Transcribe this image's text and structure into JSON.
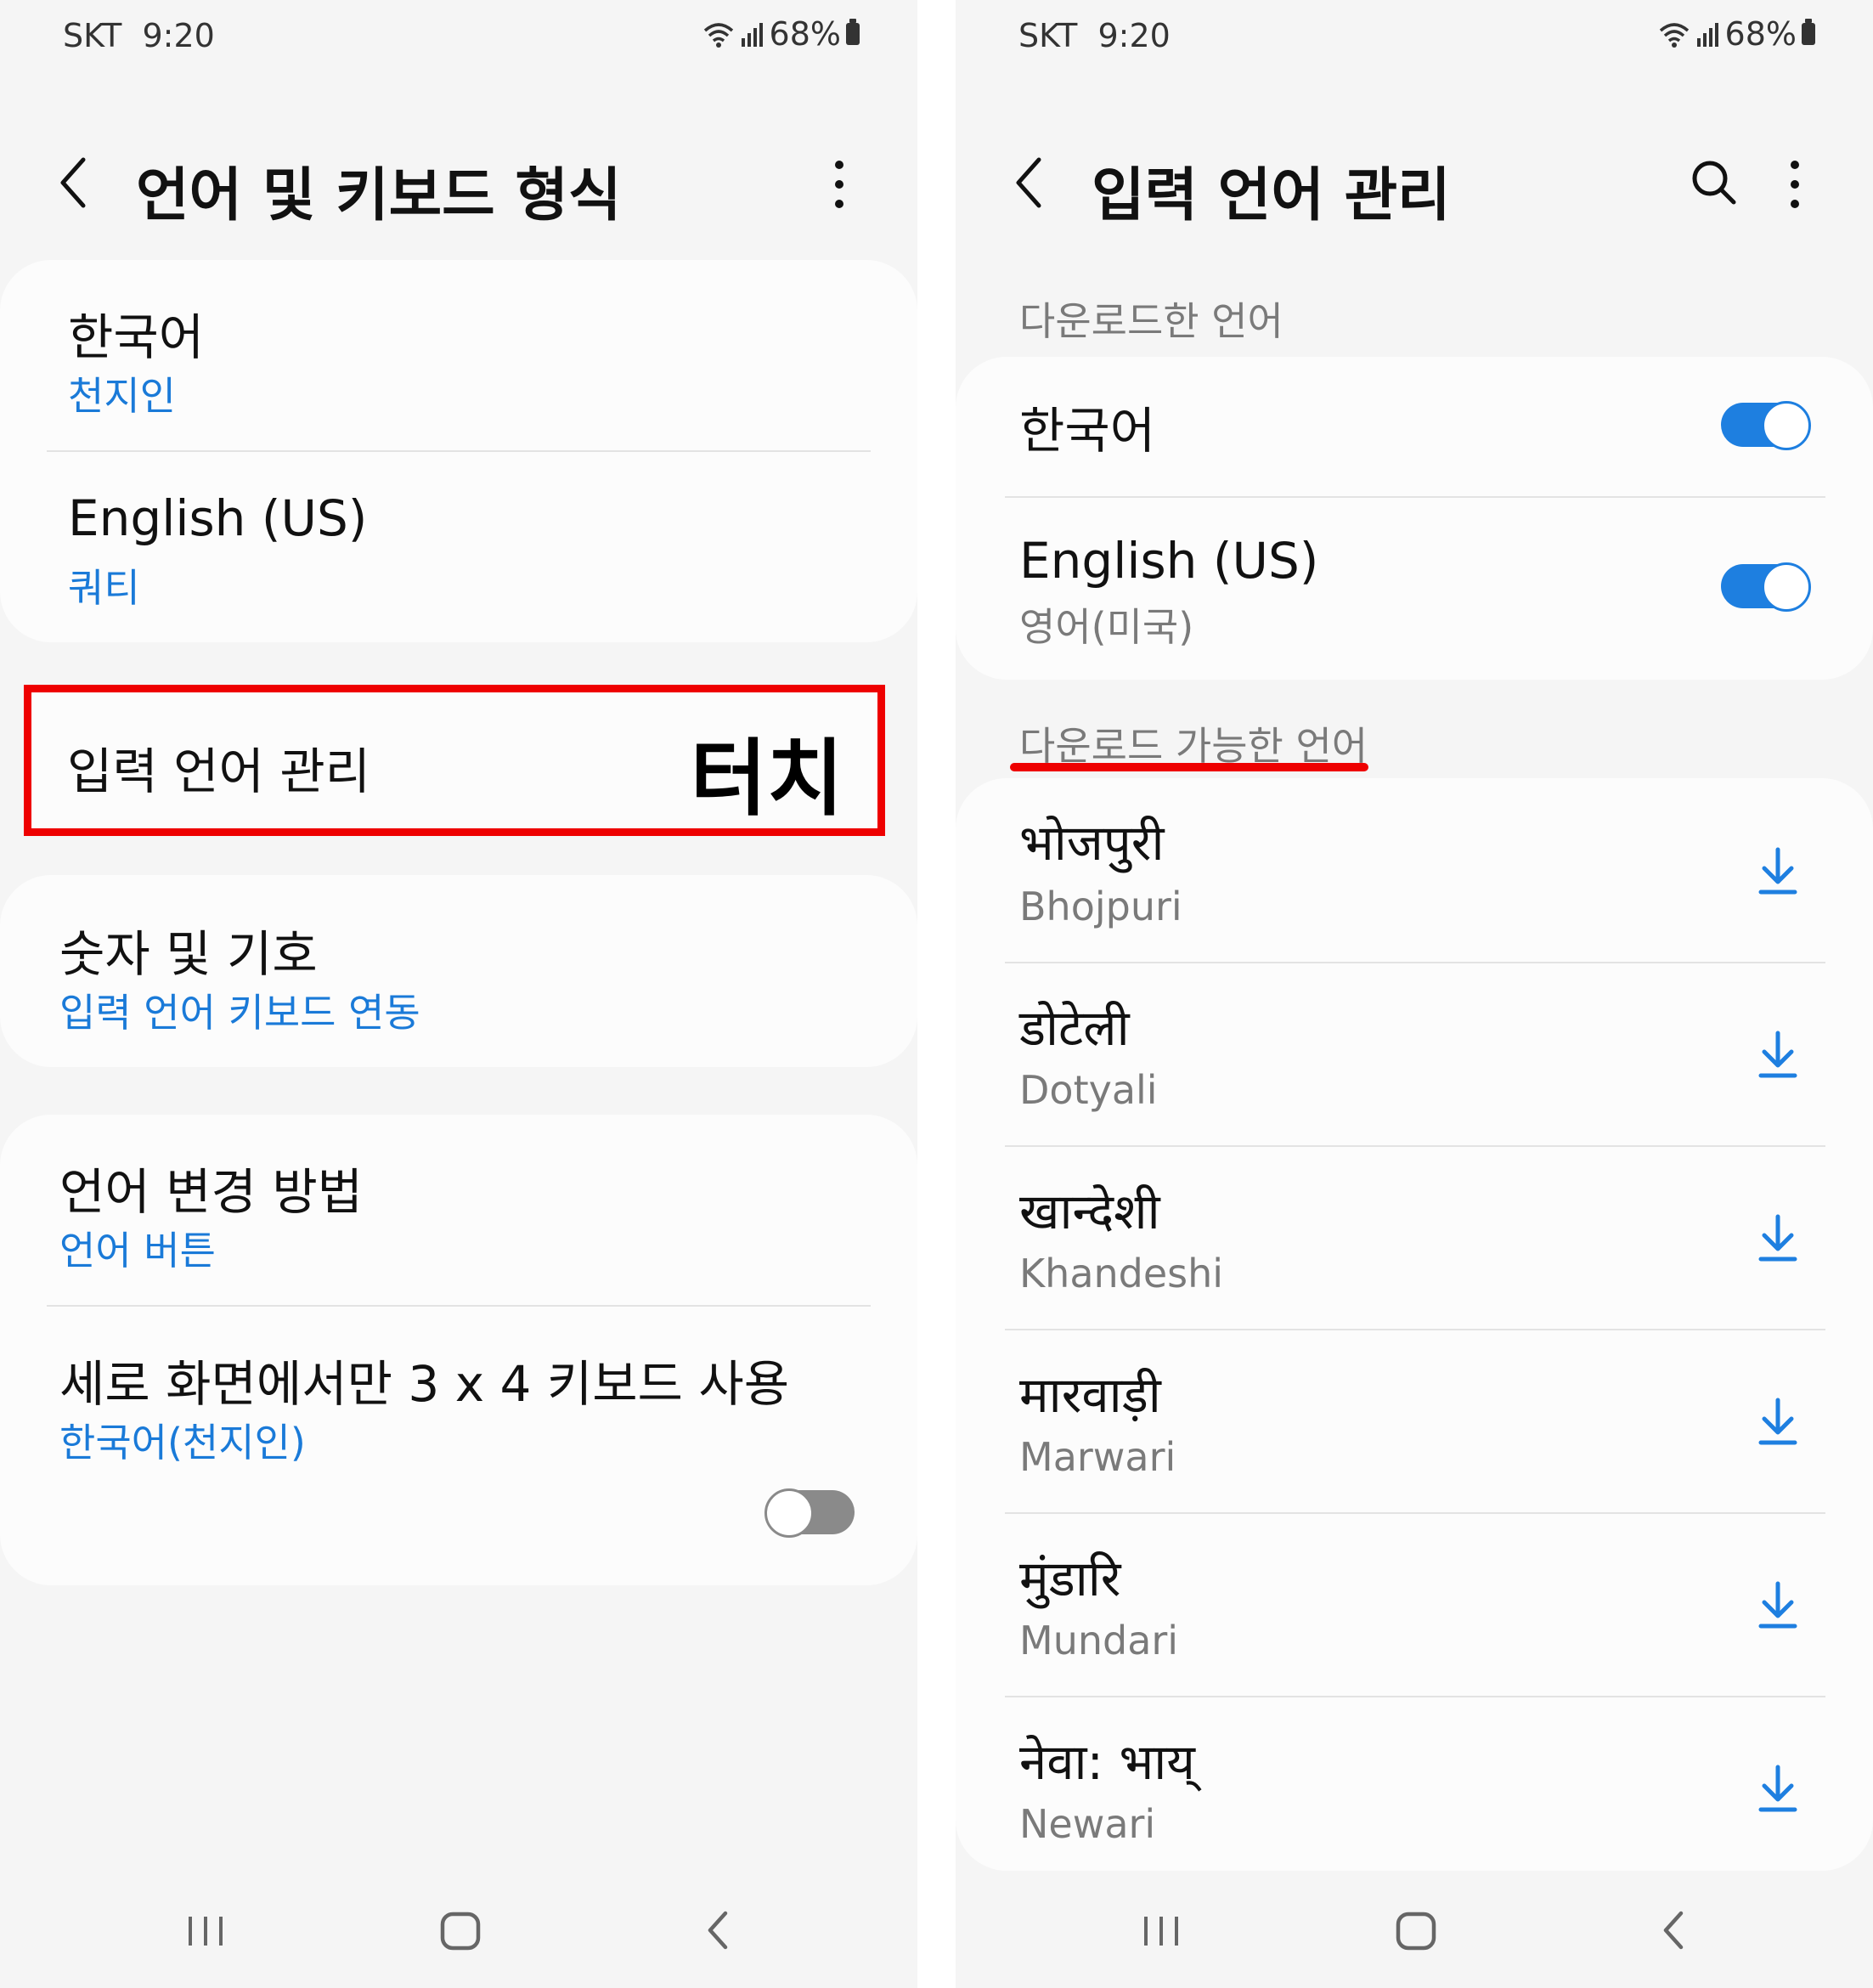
{
  "status_bar": {
    "carrier": "SKT",
    "time": "9:20",
    "battery": "68%"
  },
  "left": {
    "title": "언어 및 키보드 형식",
    "languages": [
      {
        "name": "한국어",
        "layout": "천지인"
      },
      {
        "name": "English (US)",
        "layout": "쿼티"
      }
    ],
    "manage_languages": {
      "label": "입력 언어 관리",
      "annotation": "터치"
    },
    "numbers_symbols": {
      "title": "숫자 및 기호",
      "subtitle": "입력 언어 키보드 연동"
    },
    "switch_method": {
      "title": "언어 변경 방법",
      "subtitle": "언어 버튼"
    },
    "portrait_3x4": {
      "title": "세로 화면에서만 3 x 4 키보드 사용",
      "subtitle": "한국어(천지인)",
      "enabled": false
    }
  },
  "right": {
    "title": "입력 언어 관리",
    "downloaded_header": "다운로드한 언어",
    "downloaded": [
      {
        "name": "한국어",
        "subtitle": "",
        "enabled": true
      },
      {
        "name": "English (US)",
        "subtitle": "영어(미국)",
        "enabled": true
      }
    ],
    "available_header": "다운로드 가능한 언어",
    "available": [
      {
        "name": "भोजपुरी",
        "subtitle": "Bhojpuri"
      },
      {
        "name": "डोटेली",
        "subtitle": "Dotyali"
      },
      {
        "name": "खान्देशी",
        "subtitle": "Khandeshi"
      },
      {
        "name": "मारवाड़ी",
        "subtitle": "Marwari"
      },
      {
        "name": "मुंडारि",
        "subtitle": "Mundari"
      },
      {
        "name": "नेवा: भाय्",
        "subtitle": "Newari"
      }
    ]
  },
  "colors": {
    "accent": "#1e7fe0",
    "link": "#1a7ad8",
    "highlight": "#ee0000",
    "background": "#f5f5f5",
    "card": "#fcfcfc"
  },
  "icons": [
    "back-icon",
    "more-icon",
    "search-icon",
    "download-icon",
    "recent-apps-icon",
    "home-icon",
    "nav-back-icon",
    "wifi-icon",
    "signal-icon",
    "battery-icon"
  ]
}
